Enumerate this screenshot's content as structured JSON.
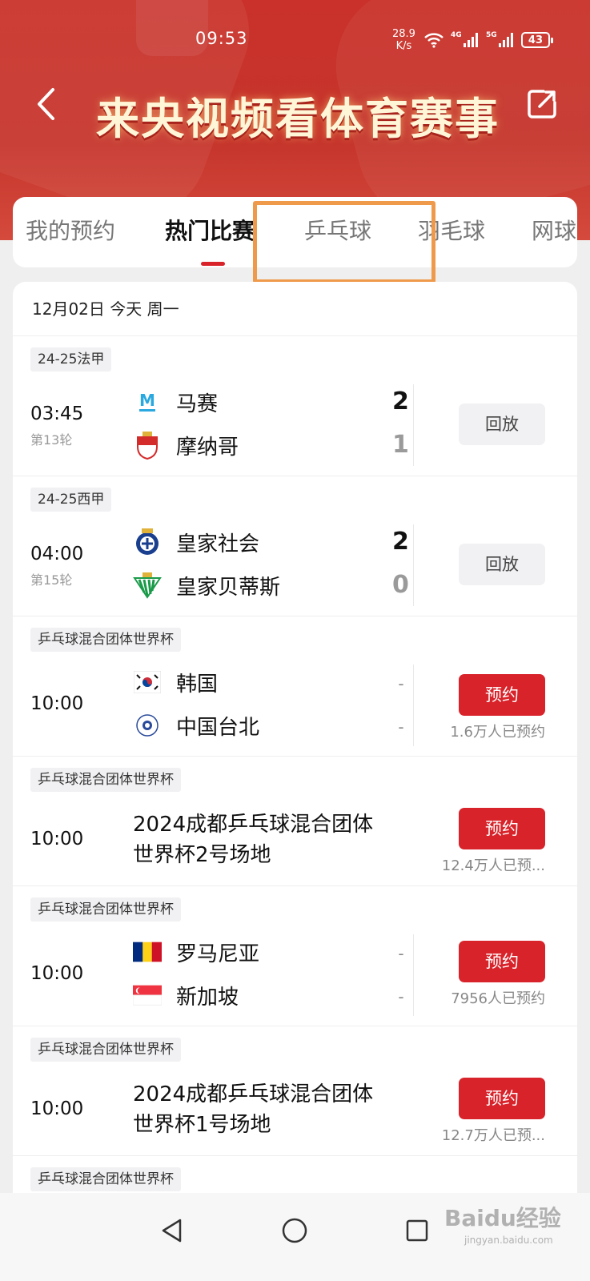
{
  "status_bar": {
    "time": "09:53",
    "net_speed_value": "28.9",
    "net_speed_unit": "K/s",
    "signal1_label": "4G",
    "signal2_label": "5G",
    "battery": "43"
  },
  "header": {
    "title": "来央视频看体育赛事",
    "back_icon": "chevron-left-icon",
    "share_icon": "share-icon"
  },
  "tabs": [
    {
      "label": "我的预约",
      "active": false
    },
    {
      "label": "热门比赛",
      "active": true
    },
    {
      "label": "乒乓球",
      "active": false
    },
    {
      "label": "羽毛球",
      "active": false
    },
    {
      "label": "网球",
      "active": false
    }
  ],
  "date_header": "12月02日 今天 周一",
  "matches": [
    {
      "league": "24-25法甲",
      "time": "03:45",
      "round": "第13轮",
      "home": {
        "name": "马赛",
        "score": "2"
      },
      "away": {
        "name": "摩纳哥",
        "score": "1"
      },
      "action": "回放"
    },
    {
      "league": "24-25西甲",
      "time": "04:00",
      "round": "第15轮",
      "home": {
        "name": "皇家社会",
        "score": "2"
      },
      "away": {
        "name": "皇家贝蒂斯",
        "score": "0"
      },
      "action": "回放"
    },
    {
      "league": "乒乓球混合团体世界杯",
      "time": "10:00",
      "home": {
        "name": "韩国",
        "score": "-"
      },
      "away": {
        "name": "中国台北",
        "score": "-"
      },
      "action": "预约",
      "reserve_count": "1.6万人已预约"
    },
    {
      "league": "乒乓球混合团体世界杯",
      "time": "10:00",
      "title_line1": "2024成都乒乓球混合团体",
      "title_line2": "世界杯2号场地",
      "action": "预约",
      "reserve_count": "12.4万人已预..."
    },
    {
      "league": "乒乓球混合团体世界杯",
      "time": "10:00",
      "home": {
        "name": "罗马尼亚",
        "score": "-"
      },
      "away": {
        "name": "新加坡",
        "score": "-"
      },
      "action": "预约",
      "reserve_count": "7956人已预约"
    },
    {
      "league": "乒乓球混合团体世界杯",
      "time": "10:00",
      "title_line1": "2024成都乒乓球混合团体",
      "title_line2": "世界杯1号场地",
      "action": "预约",
      "reserve_count": "12.7万人已预..."
    },
    {
      "league": "乒乓球混合团体世界杯"
    }
  ],
  "nav": {
    "back_icon": "triangle-back-icon",
    "home_icon": "circle-home-icon",
    "recent_icon": "square-recent-icon"
  },
  "watermark": {
    "text": "Baidu经验",
    "sub": "jingyan.baidu.com"
  },
  "colors": {
    "header_red": "#c9312a",
    "accent_red": "#d8232a",
    "highlight_orange": "#ef9a4b"
  }
}
